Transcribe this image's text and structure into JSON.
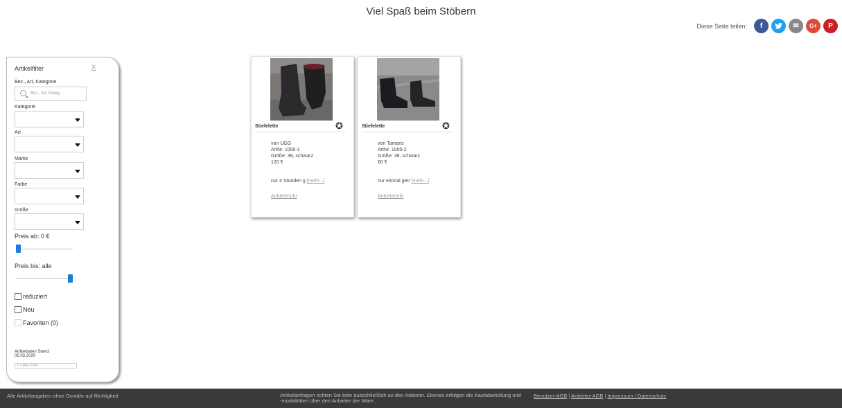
{
  "header": {
    "title": "Viel Spaß beim Stöbern"
  },
  "share": {
    "label": "Diese Seite teilen:",
    "buttons": [
      {
        "icon": "facebook-icon",
        "glyph": "f",
        "color": "#3b5998"
      },
      {
        "icon": "twitter-icon",
        "glyph": "t",
        "color": "#1da1f2"
      },
      {
        "icon": "email-icon",
        "glyph": "✉",
        "color": "#888888"
      },
      {
        "icon": "google-plus-icon",
        "glyph": "G+",
        "color": "#dd4b39"
      },
      {
        "icon": "pinterest-icon",
        "glyph": "P",
        "color": "#cb2027"
      }
    ]
  },
  "filter": {
    "title": "Artikelfilter",
    "close": "X",
    "search_label": "Bez., Art, Kategorie",
    "search_placeholder": "Bez., Art, Kateg...",
    "kategorie_label": "Kategorie",
    "art_label": "Art",
    "marke_label": "Marke",
    "farbe_label": "Farbe",
    "groesse_label": "Größe",
    "price_from_label": "Preis ab: 0 €",
    "price_from_value": 0,
    "price_to_label": "Preis bis: alle",
    "price_to_value": 1,
    "reduziert": "reduziert",
    "neu": "Neu",
    "favoriten": "Favoriten (0)",
    "stand_label": "Artikeldaten Stand:",
    "stand_date": "05.03.2020",
    "legend": "1 = alter Preis"
  },
  "products": [
    {
      "name": "Stiefelette",
      "brand": "von UGG",
      "artnr": "ArtNr. 1000-1",
      "size": "Größe: 39, schwarz",
      "price": "120 €",
      "desc": "nur 4 Stunden g",
      "more": "[mehr...]",
      "vendor": "Anbieterinfo"
    },
    {
      "name": "Stiefelette",
      "brand": "von Tamaris",
      "artnr": "ArtNr. 1000-2",
      "size": "Größe: 38, schwarz",
      "price": "60 €",
      "desc": "nur einmal getr",
      "more": "[mehr...]",
      "vendor": "Anbieterinfo"
    }
  ],
  "footer": {
    "disclaimer": "Alle Artikelangaben ohne Gewähr auf Richtigkeit",
    "notice": "Artikelanfragen richten Sie bitte ausschließlich an den Anbieter. Ebenso erfolgen die Kaufabwicklung und -modalitäten über den Anbieter der Ware.",
    "link_user_agb": "Benutzer-AGB",
    "link_anbieter_agb": "Anbieter-AGB",
    "link_impressum": "Impressum / Datenschutz",
    "separator": " | "
  }
}
